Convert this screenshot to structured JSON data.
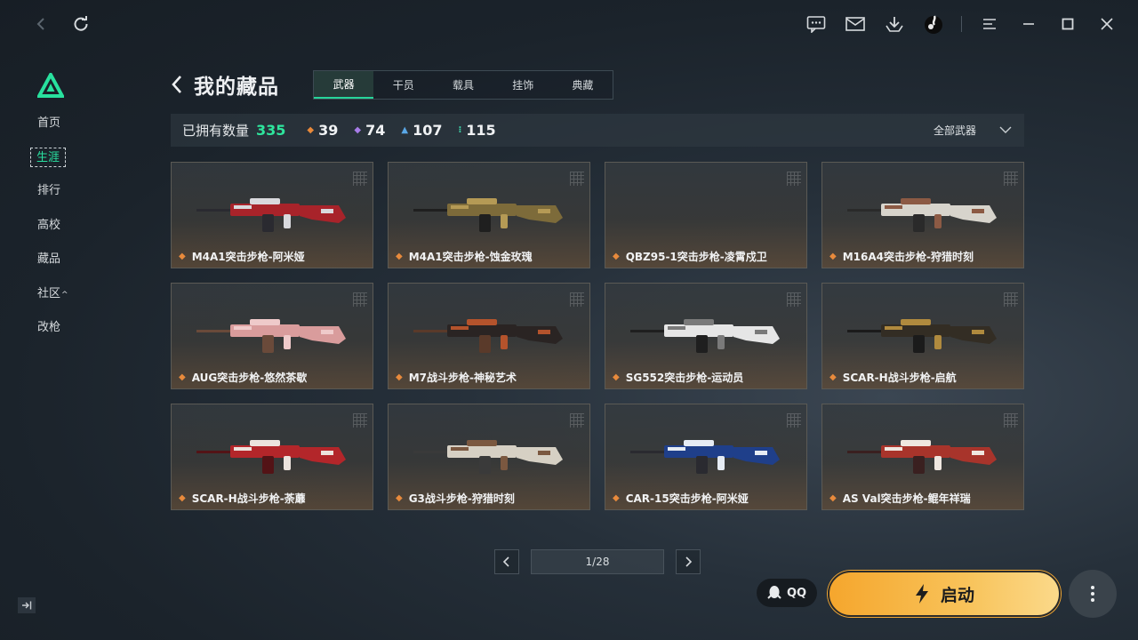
{
  "window": {
    "icons": [
      "back-icon",
      "refresh-icon",
      "chat-icon",
      "mail-icon",
      "download-icon",
      "avatar",
      "menu-icon",
      "minimize-icon",
      "maximize-icon",
      "close-icon"
    ]
  },
  "sidebar": {
    "items": [
      {
        "label": "首页"
      },
      {
        "label": "生涯",
        "active": true
      },
      {
        "label": "排行"
      },
      {
        "label": "高校"
      },
      {
        "label": "藏品"
      },
      {
        "label": "社区",
        "caret": "^"
      },
      {
        "label": "改枪"
      }
    ],
    "accent": "#29e0a0"
  },
  "header": {
    "title": "我的藏品"
  },
  "tabs": [
    {
      "label": "武器",
      "active": true
    },
    {
      "label": "干员"
    },
    {
      "label": "载具"
    },
    {
      "label": "挂饰"
    },
    {
      "label": "典藏"
    }
  ],
  "stats": {
    "owned_label": "已拥有数量",
    "owned_total": "335",
    "counts": [
      {
        "value": "39",
        "color": "#e8893a"
      },
      {
        "value": "74",
        "color": "#a77ce8"
      },
      {
        "value": "107",
        "color": "#5aa7e6"
      },
      {
        "value": "115",
        "color": "#3fcfa7"
      }
    ],
    "filter_label": "全部武器"
  },
  "items": [
    {
      "name": "M4A1突击步枪-阿米娅",
      "palette": [
        "#a8232a",
        "#d9d9dd",
        "#2a2a30"
      ]
    },
    {
      "name": "M4A1突击步枪-蚀金玫瑰",
      "palette": [
        "#7d6b3a",
        "#b59a55",
        "#1f1f1f"
      ]
    },
    {
      "name": "QBZ95-1突击步枪-凌霄戍卫",
      "palette": []
    },
    {
      "name": "M16A4突击步枪-狩猎时刻",
      "palette": [
        "#d7d4cc",
        "#8c5a44",
        "#2a2a2a"
      ]
    },
    {
      "name": "AUG突击步枪-悠然茶歇",
      "palette": [
        "#d99c9c",
        "#efcaca",
        "#6a4a3a"
      ]
    },
    {
      "name": "M7战斗步枪-神秘艺术",
      "palette": [
        "#2a2423",
        "#b4532c",
        "#5a3a2a"
      ]
    },
    {
      "name": "SG552突击步枪-运动员",
      "palette": [
        "#e6e6e6",
        "#7a7a7a",
        "#1f1f1f"
      ]
    },
    {
      "name": "SCAR-H战斗步枪-启航",
      "palette": [
        "#332d24",
        "#b08a3e",
        "#1b1b1b"
      ]
    },
    {
      "name": "SCAR-H战斗步枪-荼蘼",
      "palette": [
        "#b3262a",
        "#ece3dd",
        "#531316"
      ]
    },
    {
      "name": "G3战斗步枪-狩猎时刻",
      "palette": [
        "#d6d0c4",
        "#7b5840",
        "#3a3a3a"
      ]
    },
    {
      "name": "CAR-15突击步枪-阿米娅",
      "palette": [
        "#1f3f8a",
        "#e6ecf4",
        "#2a2a30"
      ]
    },
    {
      "name": "AS Val突击步枪-鲲年祥瑞",
      "palette": [
        "#a8342b",
        "#efe7e0",
        "#3a2020"
      ]
    }
  ],
  "pager": {
    "label": "1/28"
  },
  "bottom": {
    "qq_label": "QQ",
    "launch_label": "启动"
  }
}
